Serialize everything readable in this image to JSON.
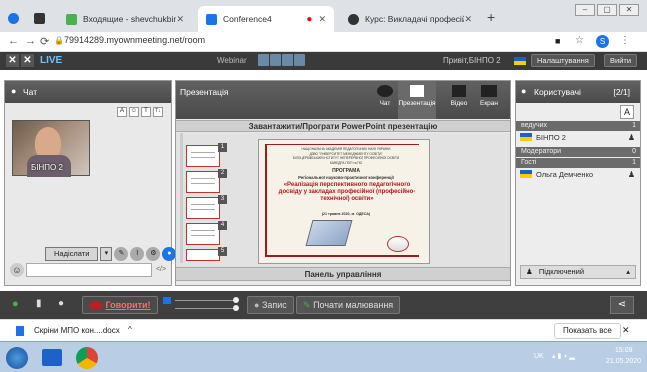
{
  "browser": {
    "tabs": [
      {
        "title": "Входящие - shevchukbinpo@uk",
        "active": false
      },
      {
        "title": "Conference4",
        "active": true
      },
      {
        "title": "Курс: Викладачі професійно-те",
        "active": false
      }
    ],
    "new_tab": "+",
    "url": "79914289.myownmeeting.net/room",
    "profile_initial": "S"
  },
  "app": {
    "live_label": "LIVE",
    "webinar_label": "Webinar",
    "greeting": "Привіт,БІНПО 2",
    "settings_label": "Налаштування",
    "exit_label": "Вийти"
  },
  "chat": {
    "title": "Чат",
    "tools": [
      "A",
      "☺",
      "T",
      "T↓"
    ],
    "video_label": "БІНПО 2",
    "send_label": "Надіслати",
    "code_glyph": "</>"
  },
  "presentation": {
    "title": "Презентація",
    "tabs": [
      "Чат",
      "Презентація",
      "Відео",
      "Екран"
    ],
    "upload_bar": "Завантажити/Програти PowerPoint презентацію",
    "control_panel": "Панель управління",
    "thumb_numbers": [
      "1",
      "2",
      "3",
      "4",
      "5"
    ],
    "slide": {
      "header_lines": [
        "НАЦІОНАЛЬНА АКАДЕМІЯ ПЕДАГОГІЧНИХ НАУК УКРАЇНИ",
        "ДЗВО \"УНІВЕРСИТЕТ МЕНЕДЖМЕНТУ ОСВІТИ\"",
        "БІЛОЦЕРКІВСЬКИЙ ІНСТИТУТ НЕПЕРЕРВНОЇ ПРОФЕСІЙНОЇ ОСВІТИ",
        "КАФЕДРА ПОП та ПО"
      ],
      "program": "ПРОГРАМА",
      "conference": "Регіональної науково-практичної конференції",
      "title": "«Реалізація перспективного педагогічного досвіду у закладах професійної (професійно-технічної) освіти»",
      "date": "(21 травня 2020, м. ОДЕСА)"
    }
  },
  "users": {
    "title": "Користувачі",
    "count": "[2/1]",
    "sections": [
      {
        "label": "ведучих",
        "count": "1",
        "users": [
          "БІНПО 2"
        ]
      },
      {
        "label": "Модератори",
        "count": "0",
        "users": []
      },
      {
        "label": "Гості",
        "count": "1",
        "users": [
          "Ольга Демченко"
        ]
      }
    ],
    "connected_label": "Підключений"
  },
  "toolbar": {
    "talk_label": "Говорити!",
    "record_label": "Запис",
    "draw_label": "Почати малювання"
  },
  "downloads": {
    "file_label": "Скріни МПО кон....docx",
    "show_all_label": "Показать все"
  },
  "taskbar": {
    "lang": "UK",
    "time": "15:09",
    "date": "21.05.2020"
  },
  "colors": {
    "live": "#6ec1ff",
    "talk_button": "#b52020",
    "accent_blue": "#1a73e8",
    "slide_border": "#a11a1a"
  }
}
